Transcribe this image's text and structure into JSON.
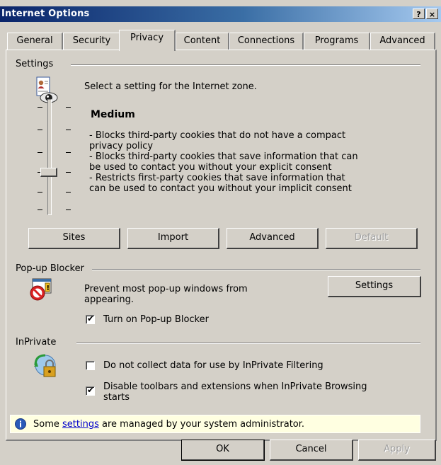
{
  "window": {
    "title": "Internet Options",
    "help_btn": "?",
    "close_btn": "×"
  },
  "tabs": [
    {
      "label": "General"
    },
    {
      "label": "Security"
    },
    {
      "label": "Privacy"
    },
    {
      "label": "Content"
    },
    {
      "label": "Connections"
    },
    {
      "label": "Programs"
    },
    {
      "label": "Advanced"
    }
  ],
  "active_tab": "Privacy",
  "settings": {
    "section_label": "Settings",
    "zone_text": "Select a setting for the Internet zone.",
    "level_title": "Medium",
    "description": [
      "- Blocks third-party cookies that do not have a compact",
      "privacy policy",
      "- Blocks third-party cookies that save information that can",
      "be used to contact you without your explicit consent",
      "- Restricts first-party cookies that save information that",
      "can be used to contact you without your implicit consent"
    ],
    "buttons": {
      "sites": "Sites",
      "import": "Import",
      "advanced": "Advanced",
      "default": "Default"
    }
  },
  "popup": {
    "section_label": "Pop-up Blocker",
    "description_line1": "Prevent most pop-up windows from",
    "description_line2": "appearing.",
    "settings_button": "Settings",
    "checkbox_label": "Turn on Pop-up Blocker",
    "checked": true
  },
  "inprivate": {
    "section_label": "InPrivate",
    "option1": "Do not collect data for use by InPrivate Filtering",
    "option1_checked": false,
    "option2_line1": "Disable toolbars and extensions when InPrivate Browsing",
    "option2_line2": "starts",
    "option2_checked": true
  },
  "admin_notice": {
    "before": "Some ",
    "link": "settings",
    "after": " are managed by your system administrator."
  },
  "footer": {
    "ok": "OK",
    "cancel": "Cancel",
    "apply": "Apply"
  }
}
